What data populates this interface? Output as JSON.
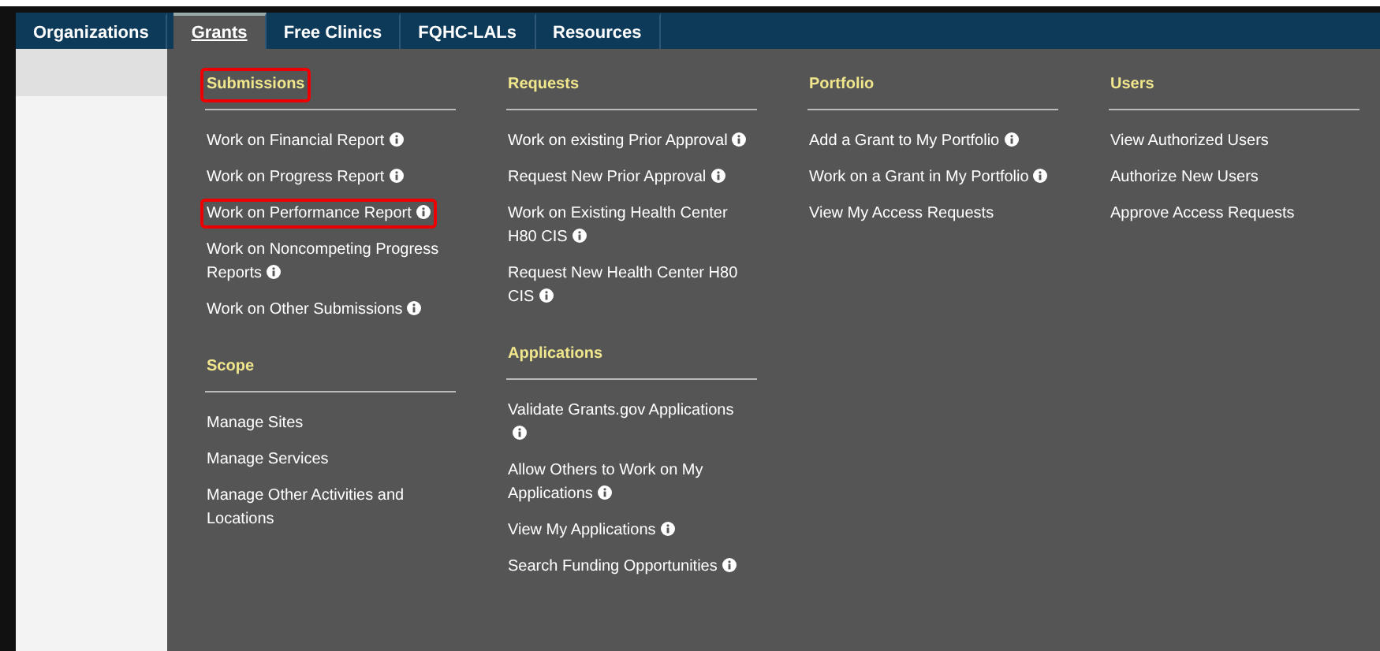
{
  "nav": {
    "tabs": [
      {
        "label": "Organizations",
        "selected": false
      },
      {
        "label": "Grants",
        "selected": true
      },
      {
        "label": "Free Clinics",
        "selected": false
      },
      {
        "label": "FQHC-LALs",
        "selected": false
      },
      {
        "label": "Resources",
        "selected": false
      }
    ]
  },
  "menu": {
    "columns": [
      {
        "sections": [
          {
            "heading": "Submissions",
            "highlighted": true,
            "items": [
              {
                "label": "Work on Financial Report",
                "info": true,
                "highlighted": false
              },
              {
                "label": "Work on Progress Report",
                "info": true,
                "highlighted": false
              },
              {
                "label": "Work on Performance Report",
                "info": true,
                "highlighted": true
              },
              {
                "label": "Work on Noncompeting Progress Reports",
                "info": true,
                "highlighted": false
              },
              {
                "label": "Work on Other Submissions",
                "info": true,
                "highlighted": false
              }
            ]
          },
          {
            "heading": "Scope",
            "highlighted": false,
            "items": [
              {
                "label": "Manage Sites",
                "info": false,
                "highlighted": false
              },
              {
                "label": "Manage Services",
                "info": false,
                "highlighted": false
              },
              {
                "label": "Manage Other Activities and Locations",
                "info": false,
                "highlighted": false
              }
            ]
          }
        ]
      },
      {
        "sections": [
          {
            "heading": "Requests",
            "highlighted": false,
            "items": [
              {
                "label": "Work on existing Prior Approval",
                "info": true,
                "highlighted": false
              },
              {
                "label": "Request New Prior Approval",
                "info": true,
                "highlighted": false
              },
              {
                "label": "Work on Existing Health Center H80 CIS",
                "info": true,
                "highlighted": false
              },
              {
                "label": "Request New Health Center H80 CIS",
                "info": true,
                "highlighted": false
              }
            ]
          },
          {
            "heading": "Applications",
            "highlighted": false,
            "items": [
              {
                "label": "Validate Grants.gov Applications",
                "info": true,
                "highlighted": false
              },
              {
                "label": "Allow Others to Work on My Applications",
                "info": true,
                "highlighted": false
              },
              {
                "label": "View My Applications",
                "info": true,
                "highlighted": false
              },
              {
                "label": "Search Funding Opportunities",
                "info": true,
                "highlighted": false
              }
            ]
          }
        ]
      },
      {
        "sections": [
          {
            "heading": "Portfolio",
            "highlighted": false,
            "items": [
              {
                "label": "Add a Grant to My Portfolio",
                "info": true,
                "highlighted": false
              },
              {
                "label": "Work on a Grant in My Portfolio",
                "info": true,
                "highlighted": false
              },
              {
                "label": "View My Access Requests",
                "info": false,
                "highlighted": false
              }
            ]
          }
        ]
      },
      {
        "sections": [
          {
            "heading": "Users",
            "highlighted": false,
            "items": [
              {
                "label": "View Authorized Users",
                "info": false,
                "highlighted": false
              },
              {
                "label": "Authorize New Users",
                "info": false,
                "highlighted": false
              },
              {
                "label": "Approve Access Requests",
                "info": false,
                "highlighted": false
              }
            ]
          }
        ]
      }
    ]
  }
}
